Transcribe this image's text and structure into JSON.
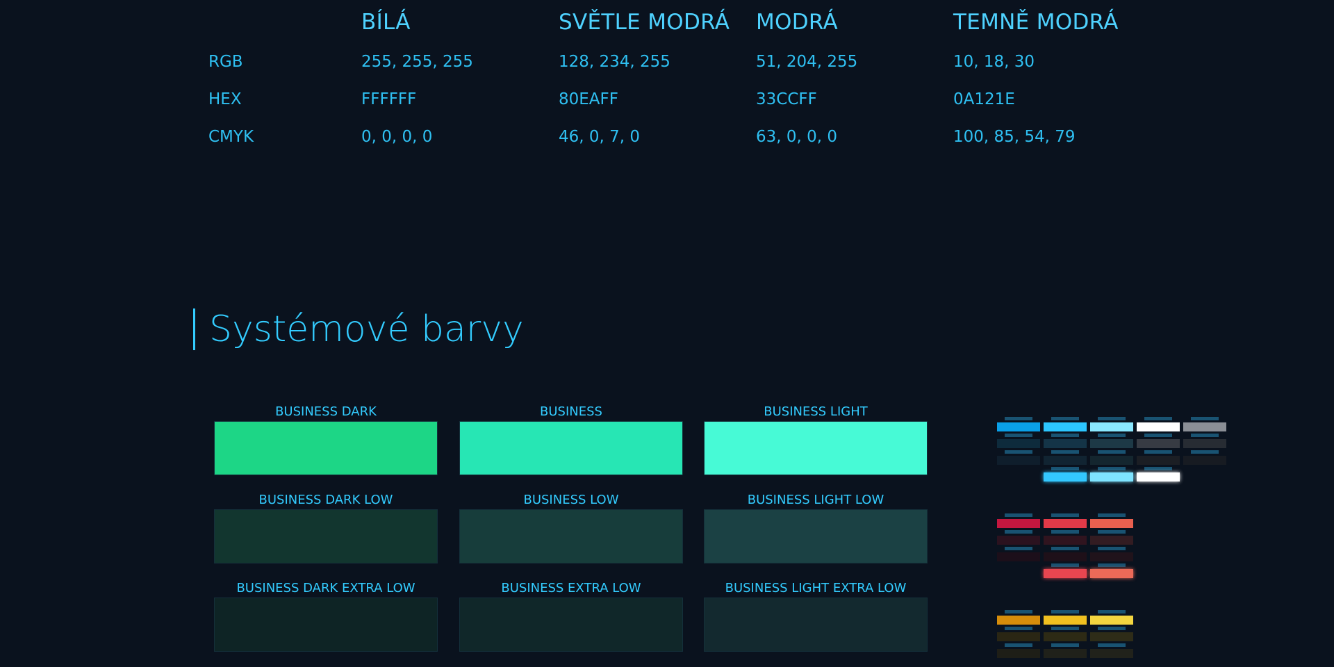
{
  "color_table": {
    "columns": [
      "BÍLÁ",
      "SVĚTLE MODRÁ",
      "MODRÁ",
      "TEMNĚ MODRÁ"
    ],
    "rows": [
      {
        "label": "RGB",
        "values": [
          "255, 255, 255",
          "128, 234, 255",
          "51, 204, 255",
          "10, 18, 30"
        ]
      },
      {
        "label": "HEX",
        "values": [
          "FFFFFF",
          "80EAFF",
          "33CCFF",
          "0A121E"
        ]
      },
      {
        "label": "CMYK",
        "values": [
          "0, 0, 0, 0",
          "46, 0, 7, 0",
          "63, 0, 0, 0",
          "100, 85, 54, 79"
        ]
      }
    ]
  },
  "section": {
    "title": "Systémové barvy"
  },
  "swatches": [
    {
      "label": "BUSINESS DARK",
      "color": "#1dd686"
    },
    {
      "label": "BUSINESS",
      "color": "#27e6b4"
    },
    {
      "label": "BUSINESS LIGHT",
      "color": "#47fad6"
    },
    {
      "label": "BUSINESS DARK LOW",
      "color": "#12362f"
    },
    {
      "label": "BUSINESS LOW",
      "color": "#173d3b"
    },
    {
      "label": "BUSINESS LIGHT LOW",
      "color": "#1b4144"
    },
    {
      "label": "BUSINESS DARK EXTRA LOW",
      "color": "#0e2425"
    },
    {
      "label": "BUSINESS EXTRA LOW",
      "color": "#102729"
    },
    {
      "label": "BUSINESS LIGHT EXTRA LOW",
      "color": "#13292f"
    }
  ],
  "mini_palette": {
    "blue": [
      "#0aa0e8",
      "#2cc6ff",
      "#8ae8ff",
      "#ffffff",
      "#8b8f96"
    ],
    "blue_low": [
      "#0e2b3c",
      "#143447",
      "#1d3946",
      "#373b43",
      "#272c33"
    ],
    "blue_extra_low": [
      "#0f1e2c",
      "#112432",
      "#14262f",
      "#1b1e24",
      "#171b22"
    ],
    "blue_glow": [
      "#33c8ff",
      "#7ee4ff",
      "#ffffff"
    ],
    "red": [
      "#c4173f",
      "#e23a48",
      "#e9604f"
    ],
    "red_low": [
      "#2b121f",
      "#30141f",
      "#331c22"
    ],
    "red_extra_low": [
      "#1c0f1a",
      "#1e1019",
      "#20131b"
    ],
    "red_glow": [
      "#e84650",
      "#ec6a58"
    ],
    "yellow": [
      "#d68d0b",
      "#f0c020",
      "#f4d640"
    ],
    "yellow_low": [
      "#2a2614",
      "#2d2a15",
      "#2e2c18"
    ],
    "yellow_extra_low": [
      "#1e1e17",
      "#20211a",
      "#21221b"
    ],
    "yellow_glow": [
      "#f2c31e",
      "#f5d43c"
    ]
  }
}
